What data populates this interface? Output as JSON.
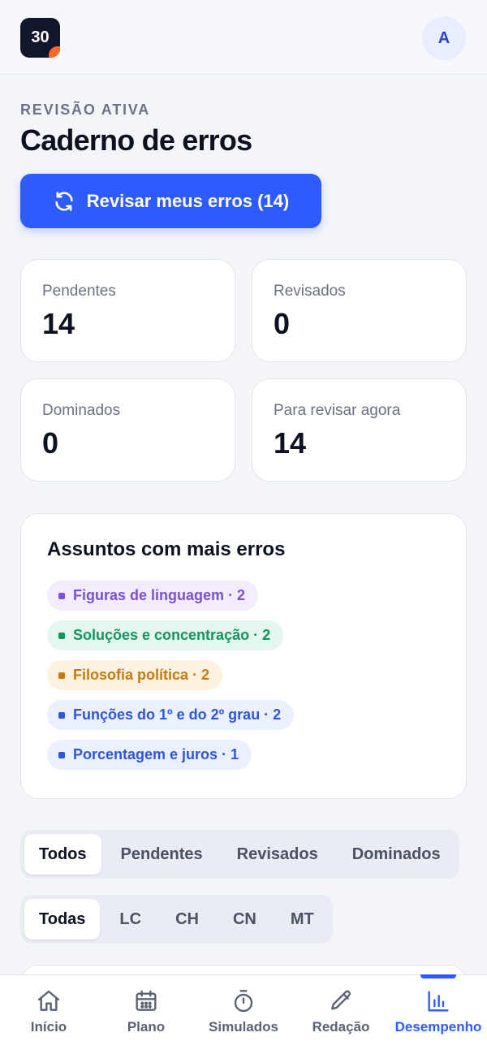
{
  "header": {
    "logo_text": "30",
    "avatar_initial": "A"
  },
  "page": {
    "eyebrow": "REVISÃO ATIVA",
    "title": "Caderno de erros"
  },
  "review_button": {
    "label": "Revisar meus erros (14)",
    "icon": "refresh-icon"
  },
  "stats": [
    {
      "label": "Pendentes",
      "value": "14"
    },
    {
      "label": "Revisados",
      "value": "0"
    },
    {
      "label": "Dominados",
      "value": "0"
    },
    {
      "label": "Para revisar agora",
      "value": "14"
    }
  ],
  "subjects": {
    "title": "Assuntos com mais erros",
    "items": [
      {
        "label": "Figuras de linguagem · 2",
        "color": "#7b4fd6",
        "bg": "#f2ecfd"
      },
      {
        "label": "Soluções e concentração · 2",
        "color": "#12955e",
        "bg": "#e4f6ee"
      },
      {
        "label": "Filosofia política · 2",
        "color": "#c77a0f",
        "bg": "#fdf2df"
      },
      {
        "label": "Funções do 1º e do 2º grau · 2",
        "color": "#2f55e0",
        "bg": "#eaf0fe"
      },
      {
        "label": "Porcentagem e juros · 1",
        "color": "#2f55e0",
        "bg": "#eaf0fe"
      }
    ]
  },
  "status_filter": {
    "options": [
      "Todos",
      "Pendentes",
      "Revisados",
      "Dominados"
    ],
    "selected": "Todos"
  },
  "area_filter": {
    "options": [
      "Todas",
      "LC",
      "CH",
      "CN",
      "MT"
    ],
    "selected": "Todas"
  },
  "bottom_nav": {
    "items": [
      {
        "label": "Início",
        "icon": "home-icon"
      },
      {
        "label": "Plano",
        "icon": "calendar-icon"
      },
      {
        "label": "Simulados",
        "icon": "stopwatch-icon"
      },
      {
        "label": "Redação",
        "icon": "pencil-icon"
      },
      {
        "label": "Desempenho",
        "icon": "bar-chart-icon"
      }
    ],
    "active": "Desempenho"
  },
  "colors": {
    "accent": "#2e5bff",
    "ink": "#0d1220",
    "muted": "#6b7283"
  }
}
